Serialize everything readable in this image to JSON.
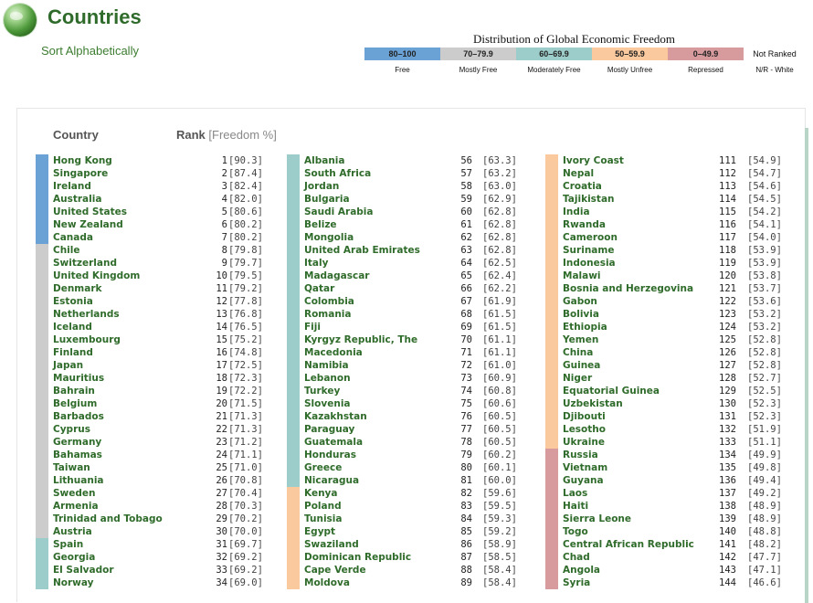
{
  "header": {
    "title": "Countries",
    "sort_link": "Sort Alphabetically"
  },
  "legend": {
    "title": "Distribution of Global Economic Freedom",
    "segments": [
      {
        "range": "80–100",
        "label": "Free",
        "color": "#6aa2d6"
      },
      {
        "range": "70–79.9",
        "label": "Mostly Free",
        "color": "#cccccc"
      },
      {
        "range": "60–69.9",
        "label": "Moderately Free",
        "color": "#9dcdca"
      },
      {
        "range": "50–59.9",
        "label": "Mostly Unfree",
        "color": "#fbc99e"
      },
      {
        "range": "0–49.9",
        "label": "Repressed",
        "color": "#d79b9e"
      }
    ],
    "not_ranked": {
      "label": "Not Ranked",
      "caption": "N/R - White"
    }
  },
  "table": {
    "header_country": "Country",
    "header_rank": "Rank",
    "header_pct": "[Freedom %]",
    "categories": {
      "free": "#6aa2d6",
      "mostly_free": "#cccccc",
      "moderately_free": "#9dcdca",
      "mostly_unfree": "#fbc99e",
      "repressed": "#d79b9e"
    },
    "rows": [
      {
        "name": "Hong Kong",
        "rank": "1",
        "score": "[90.3]",
        "cat": "free"
      },
      {
        "name": "Singapore",
        "rank": "2",
        "score": "[87.4]",
        "cat": "free"
      },
      {
        "name": "Ireland",
        "rank": "3",
        "score": "[82.4]",
        "cat": "free"
      },
      {
        "name": "Australia",
        "rank": "4",
        "score": "[82.0]",
        "cat": "free"
      },
      {
        "name": "United States",
        "rank": "5",
        "score": "[80.6]",
        "cat": "free"
      },
      {
        "name": "New Zealand",
        "rank": "6",
        "score": "[80.2]",
        "cat": "free"
      },
      {
        "name": "Canada",
        "rank": "7",
        "score": "[80.2]",
        "cat": "free"
      },
      {
        "name": "Chile",
        "rank": "8",
        "score": "[79.8]",
        "cat": "mostly_free"
      },
      {
        "name": "Switzerland",
        "rank": "9",
        "score": "[79.7]",
        "cat": "mostly_free"
      },
      {
        "name": "United Kingdom",
        "rank": "10",
        "score": "[79.5]",
        "cat": "mostly_free"
      },
      {
        "name": "Denmark",
        "rank": "11",
        "score": "[79.2]",
        "cat": "mostly_free"
      },
      {
        "name": "Estonia",
        "rank": "12",
        "score": "[77.8]",
        "cat": "mostly_free"
      },
      {
        "name": "Netherlands",
        "rank": "13",
        "score": "[76.8]",
        "cat": "mostly_free"
      },
      {
        "name": "Iceland",
        "rank": "14",
        "score": "[76.5]",
        "cat": "mostly_free"
      },
      {
        "name": "Luxembourg",
        "rank": "15",
        "score": "[75.2]",
        "cat": "mostly_free"
      },
      {
        "name": "Finland",
        "rank": "16",
        "score": "[74.8]",
        "cat": "mostly_free"
      },
      {
        "name": "Japan",
        "rank": "17",
        "score": "[72.5]",
        "cat": "mostly_free"
      },
      {
        "name": "Mauritius",
        "rank": "18",
        "score": "[72.3]",
        "cat": "mostly_free"
      },
      {
        "name": "Bahrain",
        "rank": "19",
        "score": "[72.2]",
        "cat": "mostly_free"
      },
      {
        "name": "Belgium",
        "rank": "20",
        "score": "[71.5]",
        "cat": "mostly_free"
      },
      {
        "name": "Barbados",
        "rank": "21",
        "score": "[71.3]",
        "cat": "mostly_free"
      },
      {
        "name": "Cyprus",
        "rank": "22",
        "score": "[71.3]",
        "cat": "mostly_free"
      },
      {
        "name": "Germany",
        "rank": "23",
        "score": "[71.2]",
        "cat": "mostly_free"
      },
      {
        "name": "Bahamas",
        "rank": "24",
        "score": "[71.1]",
        "cat": "mostly_free"
      },
      {
        "name": "Taiwan",
        "rank": "25",
        "score": "[71.0]",
        "cat": "mostly_free"
      },
      {
        "name": "Lithuania",
        "rank": "26",
        "score": "[70.8]",
        "cat": "mostly_free"
      },
      {
        "name": "Sweden",
        "rank": "27",
        "score": "[70.4]",
        "cat": "mostly_free"
      },
      {
        "name": "Armenia",
        "rank": "28",
        "score": "[70.3]",
        "cat": "mostly_free"
      },
      {
        "name": "Trinidad and Tobago",
        "rank": "29",
        "score": "[70.2]",
        "cat": "mostly_free"
      },
      {
        "name": "Austria",
        "rank": "30",
        "score": "[70.0]",
        "cat": "mostly_free"
      },
      {
        "name": "Spain",
        "rank": "31",
        "score": "[69.7]",
        "cat": "moderately_free"
      },
      {
        "name": "Georgia",
        "rank": "32",
        "score": "[69.2]",
        "cat": "moderately_free"
      },
      {
        "name": "El Salvador",
        "rank": "33",
        "score": "[69.2]",
        "cat": "moderately_free"
      },
      {
        "name": "Norway",
        "rank": "34",
        "score": "[69.0]",
        "cat": "moderately_free"
      },
      {
        "name": "Albania",
        "rank": "56",
        "score": "[63.3]",
        "cat": "moderately_free"
      },
      {
        "name": "South Africa",
        "rank": "57",
        "score": "[63.2]",
        "cat": "moderately_free"
      },
      {
        "name": "Jordan",
        "rank": "58",
        "score": "[63.0]",
        "cat": "moderately_free"
      },
      {
        "name": "Bulgaria",
        "rank": "59",
        "score": "[62.9]",
        "cat": "moderately_free"
      },
      {
        "name": "Saudi Arabia",
        "rank": "60",
        "score": "[62.8]",
        "cat": "moderately_free"
      },
      {
        "name": "Belize",
        "rank": "61",
        "score": "[62.8]",
        "cat": "moderately_free"
      },
      {
        "name": "Mongolia",
        "rank": "62",
        "score": "[62.8]",
        "cat": "moderately_free"
      },
      {
        "name": "United Arab Emirates",
        "rank": "63",
        "score": "[62.8]",
        "cat": "moderately_free"
      },
      {
        "name": "Italy",
        "rank": "64",
        "score": "[62.5]",
        "cat": "moderately_free"
      },
      {
        "name": "Madagascar",
        "rank": "65",
        "score": "[62.4]",
        "cat": "moderately_free"
      },
      {
        "name": "Qatar",
        "rank": "66",
        "score": "[62.2]",
        "cat": "moderately_free"
      },
      {
        "name": "Colombia",
        "rank": "67",
        "score": "[61.9]",
        "cat": "moderately_free"
      },
      {
        "name": "Romania",
        "rank": "68",
        "score": "[61.5]",
        "cat": "moderately_free"
      },
      {
        "name": "Fiji",
        "rank": "69",
        "score": "[61.5]",
        "cat": "moderately_free"
      },
      {
        "name": "Kyrgyz Republic, The",
        "rank": "70",
        "score": "[61.1]",
        "cat": "moderately_free"
      },
      {
        "name": "Macedonia",
        "rank": "71",
        "score": "[61.1]",
        "cat": "moderately_free"
      },
      {
        "name": "Namibia",
        "rank": "72",
        "score": "[61.0]",
        "cat": "moderately_free"
      },
      {
        "name": "Lebanon",
        "rank": "73",
        "score": "[60.9]",
        "cat": "moderately_free"
      },
      {
        "name": "Turkey",
        "rank": "74",
        "score": "[60.8]",
        "cat": "moderately_free"
      },
      {
        "name": "Slovenia",
        "rank": "75",
        "score": "[60.6]",
        "cat": "moderately_free"
      },
      {
        "name": "Kazakhstan",
        "rank": "76",
        "score": "[60.5]",
        "cat": "moderately_free"
      },
      {
        "name": "Paraguay",
        "rank": "77",
        "score": "[60.5]",
        "cat": "moderately_free"
      },
      {
        "name": "Guatemala",
        "rank": "78",
        "score": "[60.5]",
        "cat": "moderately_free"
      },
      {
        "name": "Honduras",
        "rank": "79",
        "score": "[60.2]",
        "cat": "moderately_free"
      },
      {
        "name": "Greece",
        "rank": "80",
        "score": "[60.1]",
        "cat": "moderately_free"
      },
      {
        "name": "Nicaragua",
        "rank": "81",
        "score": "[60.0]",
        "cat": "moderately_free"
      },
      {
        "name": "Kenya",
        "rank": "82",
        "score": "[59.6]",
        "cat": "mostly_unfree"
      },
      {
        "name": "Poland",
        "rank": "83",
        "score": "[59.5]",
        "cat": "mostly_unfree"
      },
      {
        "name": "Tunisia",
        "rank": "84",
        "score": "[59.3]",
        "cat": "mostly_unfree"
      },
      {
        "name": "Egypt",
        "rank": "85",
        "score": "[59.2]",
        "cat": "mostly_unfree"
      },
      {
        "name": "Swaziland",
        "rank": "86",
        "score": "[58.9]",
        "cat": "mostly_unfree"
      },
      {
        "name": "Dominican Republic",
        "rank": "87",
        "score": "[58.5]",
        "cat": "mostly_unfree"
      },
      {
        "name": "Cape Verde",
        "rank": "88",
        "score": "[58.4]",
        "cat": "mostly_unfree"
      },
      {
        "name": "Moldova",
        "rank": "89",
        "score": "[58.4]",
        "cat": "mostly_unfree"
      },
      {
        "name": "Ivory Coast",
        "rank": "111",
        "score": "[54.9]",
        "cat": "mostly_unfree"
      },
      {
        "name": "Nepal",
        "rank": "112",
        "score": "[54.7]",
        "cat": "mostly_unfree"
      },
      {
        "name": "Croatia",
        "rank": "113",
        "score": "[54.6]",
        "cat": "mostly_unfree"
      },
      {
        "name": "Tajikistan",
        "rank": "114",
        "score": "[54.5]",
        "cat": "mostly_unfree"
      },
      {
        "name": "India",
        "rank": "115",
        "score": "[54.2]",
        "cat": "mostly_unfree"
      },
      {
        "name": "Rwanda",
        "rank": "116",
        "score": "[54.1]",
        "cat": "mostly_unfree"
      },
      {
        "name": "Cameroon",
        "rank": "117",
        "score": "[54.0]",
        "cat": "mostly_unfree"
      },
      {
        "name": "Suriname",
        "rank": "118",
        "score": "[53.9]",
        "cat": "mostly_unfree"
      },
      {
        "name": "Indonesia",
        "rank": "119",
        "score": "[53.9]",
        "cat": "mostly_unfree"
      },
      {
        "name": "Malawi",
        "rank": "120",
        "score": "[53.8]",
        "cat": "mostly_unfree"
      },
      {
        "name": "Bosnia and Herzegovina",
        "rank": "121",
        "score": "[53.7]",
        "cat": "mostly_unfree"
      },
      {
        "name": "Gabon",
        "rank": "122",
        "score": "[53.6]",
        "cat": "mostly_unfree"
      },
      {
        "name": "Bolivia",
        "rank": "123",
        "score": "[53.2]",
        "cat": "mostly_unfree"
      },
      {
        "name": "Ethiopia",
        "rank": "124",
        "score": "[53.2]",
        "cat": "mostly_unfree"
      },
      {
        "name": "Yemen",
        "rank": "125",
        "score": "[52.8]",
        "cat": "mostly_unfree"
      },
      {
        "name": "China",
        "rank": "126",
        "score": "[52.8]",
        "cat": "mostly_unfree"
      },
      {
        "name": "Guinea",
        "rank": "127",
        "score": "[52.8]",
        "cat": "mostly_unfree"
      },
      {
        "name": "Niger",
        "rank": "128",
        "score": "[52.7]",
        "cat": "mostly_unfree"
      },
      {
        "name": "Equatorial Guinea",
        "rank": "129",
        "score": "[52.5]",
        "cat": "mostly_unfree"
      },
      {
        "name": "Uzbekistan",
        "rank": "130",
        "score": "[52.3]",
        "cat": "mostly_unfree"
      },
      {
        "name": "Djibouti",
        "rank": "131",
        "score": "[52.3]",
        "cat": "mostly_unfree"
      },
      {
        "name": "Lesotho",
        "rank": "132",
        "score": "[51.9]",
        "cat": "mostly_unfree"
      },
      {
        "name": "Ukraine",
        "rank": "133",
        "score": "[51.1]",
        "cat": "mostly_unfree"
      },
      {
        "name": "Russia",
        "rank": "134",
        "score": "[49.9]",
        "cat": "repressed"
      },
      {
        "name": "Vietnam",
        "rank": "135",
        "score": "[49.8]",
        "cat": "repressed"
      },
      {
        "name": "Guyana",
        "rank": "136",
        "score": "[49.4]",
        "cat": "repressed"
      },
      {
        "name": "Laos",
        "rank": "137",
        "score": "[49.2]",
        "cat": "repressed"
      },
      {
        "name": "Haiti",
        "rank": "138",
        "score": "[48.9]",
        "cat": "repressed"
      },
      {
        "name": "Sierra Leone",
        "rank": "139",
        "score": "[48.9]",
        "cat": "repressed"
      },
      {
        "name": "Togo",
        "rank": "140",
        "score": "[48.8]",
        "cat": "repressed"
      },
      {
        "name": "Central African Republic",
        "rank": "141",
        "score": "[48.2]",
        "cat": "repressed"
      },
      {
        "name": "Chad",
        "rank": "142",
        "score": "[47.7]",
        "cat": "repressed"
      },
      {
        "name": "Angola",
        "rank": "143",
        "score": "[47.1]",
        "cat": "repressed"
      },
      {
        "name": "Syria",
        "rank": "144",
        "score": "[46.6]",
        "cat": "repressed"
      }
    ]
  }
}
